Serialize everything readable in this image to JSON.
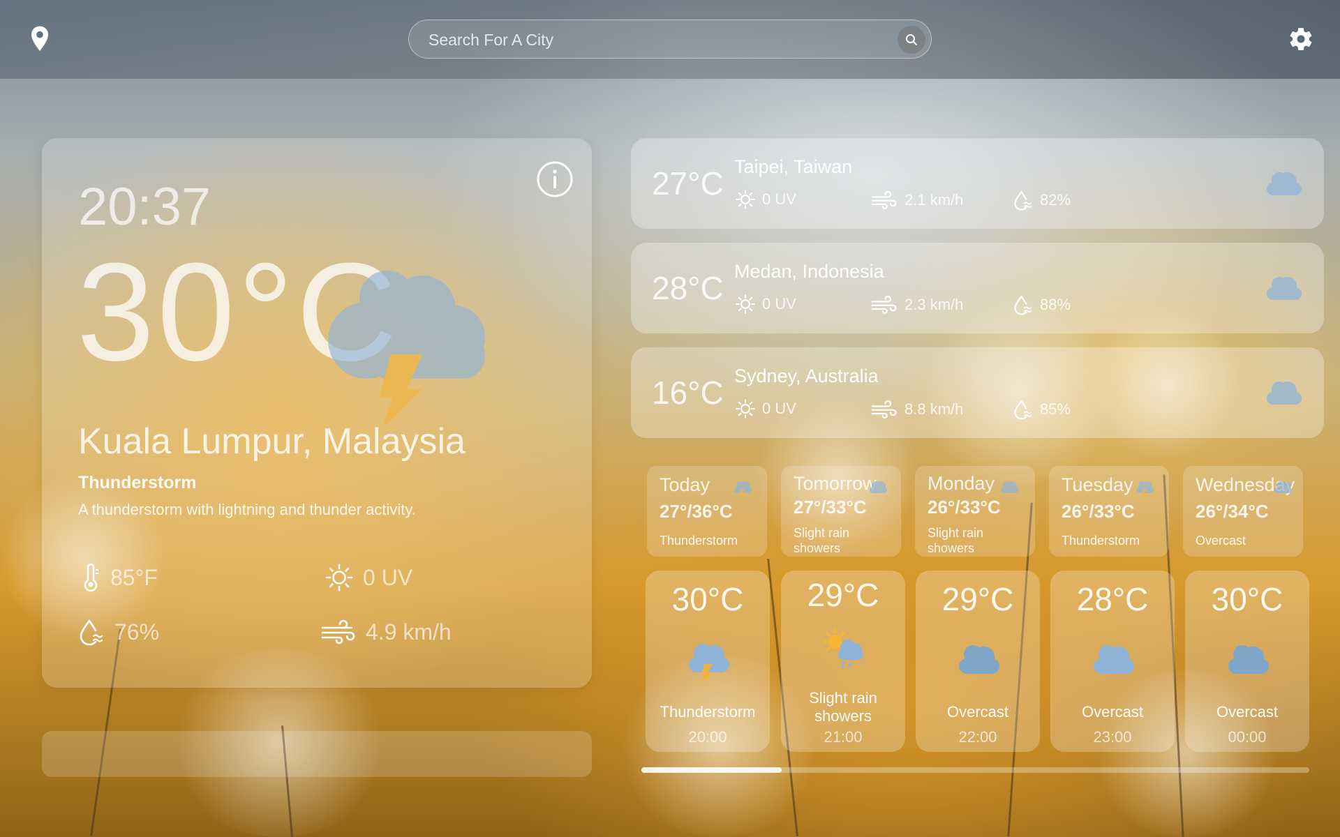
{
  "search": {
    "placeholder": "Search For A City"
  },
  "current": {
    "time": "20:37",
    "temperature": "30°C",
    "city": "Kuala Lumpur, Malaysia",
    "condition": "Thunderstorm",
    "description": "A thunderstorm with lightning and thunder activity.",
    "feels_like": "85°F",
    "uv": "0 UV",
    "humidity": "76%",
    "wind": "4.9 km/h",
    "icon": "thunderstorm-icon"
  },
  "cities": [
    {
      "temp": "27°C",
      "name": "Taipei, Taiwan",
      "uv": "0 UV",
      "wind": "2.1 km/h",
      "humidity": "82%",
      "icon": "cloud-icon"
    },
    {
      "temp": "28°C",
      "name": "Medan, Indonesia",
      "uv": "0 UV",
      "wind": "2.3 km/h",
      "humidity": "88%",
      "icon": "cloud-icon"
    },
    {
      "temp": "16°C",
      "name": "Sydney, Australia",
      "uv": "0 UV",
      "wind": "8.8 km/h",
      "humidity": "85%",
      "icon": "cloud-icon"
    }
  ],
  "daily": [
    {
      "day": "Today",
      "range": "27°/36°C",
      "condition": "Thunderstorm",
      "icon": "thunderstorm-icon"
    },
    {
      "day": "Tomorrow",
      "range": "27°/33°C",
      "condition": "Slight rain showers",
      "icon": "rain-cloud-icon"
    },
    {
      "day": "Monday",
      "range": "26°/33°C",
      "condition": "Slight rain showers",
      "icon": "rain-cloud-icon"
    },
    {
      "day": "Tuesday",
      "range": "26°/33°C",
      "condition": "Thunderstorm",
      "icon": "thunderstorm-icon"
    },
    {
      "day": "Wednesday",
      "range": "26°/34°C",
      "condition": "Overcast",
      "icon": "cloud-icon"
    }
  ],
  "hourly": [
    {
      "temp": "30°C",
      "condition": "Thunderstorm",
      "time": "20:00",
      "icon": "thunderstorm-icon"
    },
    {
      "temp": "29°C",
      "condition": "Slight rain showers",
      "time": "21:00",
      "icon": "sun-rain-cloud-icon"
    },
    {
      "temp": "29°C",
      "condition": "Overcast",
      "time": "22:00",
      "icon": "cloud-icon"
    },
    {
      "temp": "28°C",
      "condition": "Overcast",
      "time": "23:00",
      "icon": "cloud-icon"
    },
    {
      "temp": "30°C",
      "condition": "Overcast",
      "time": "00:00",
      "icon": "cloud-icon"
    }
  ],
  "hourly_scroll_fraction": 0.21,
  "colors": {
    "cloud": "#8fb4d8",
    "bolt": "#f2b33d",
    "sun": "#f7b531"
  }
}
